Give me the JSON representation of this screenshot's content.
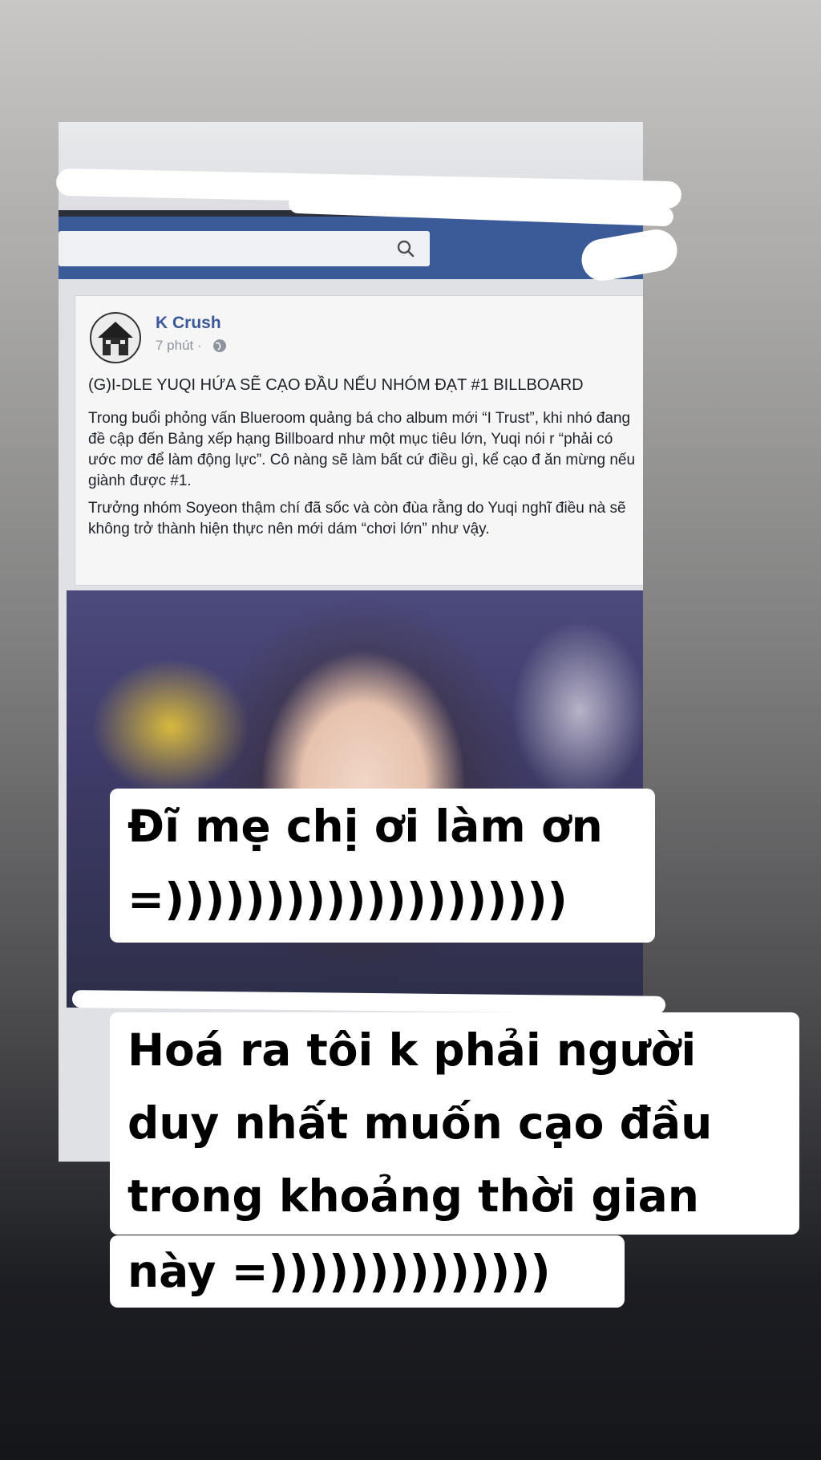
{
  "post": {
    "page_name": "K Crush",
    "time": "7 phút ·",
    "headline": "(G)I-DLE YUQI HỨA SẼ CẠO ĐẦU NẾU NHÓM ĐẠT #1 BILLBOARD",
    "body_paragraph_1": "Trong buổi phỏng vấn Blueroom quảng bá cho album mới “I Trust”, khi nhó đang đề cập đến Bảng xếp hạng Billboard như một mục tiêu lớn, Yuqi nói r “phải có ước mơ để làm động lực”. Cô nàng sẽ làm bất cứ điều gì, kể cạo đ ăn mừng nếu giành được #1.",
    "body_paragraph_2": "Trưởng nhóm Soyeon thậm chí đã sốc và còn đùa rằng do Yuqi nghĩ điều nà sẽ không trở thành hiện thực nên mới dám “chơi lớn” như vậy."
  },
  "captions": {
    "top_line_1": "Đĩ mẹ chị ơi làm ơn",
    "top_line_2": "=))))))))))))))))))))",
    "bottom_line_1": "Hoá ra tôi k phải người",
    "bottom_line_2": "duy nhất muốn cạo đầu",
    "bottom_line_3": "trong khoảng thời gian",
    "bottom_line_4": "này =))))))))))))))"
  },
  "colors": {
    "facebook_blue": "#3b5a98",
    "caption_bg": "#ffffff",
    "caption_text": "#000000"
  },
  "icons": {
    "search": "search-icon",
    "globe": "globe-icon",
    "avatar": "k-crush-house-logo"
  }
}
